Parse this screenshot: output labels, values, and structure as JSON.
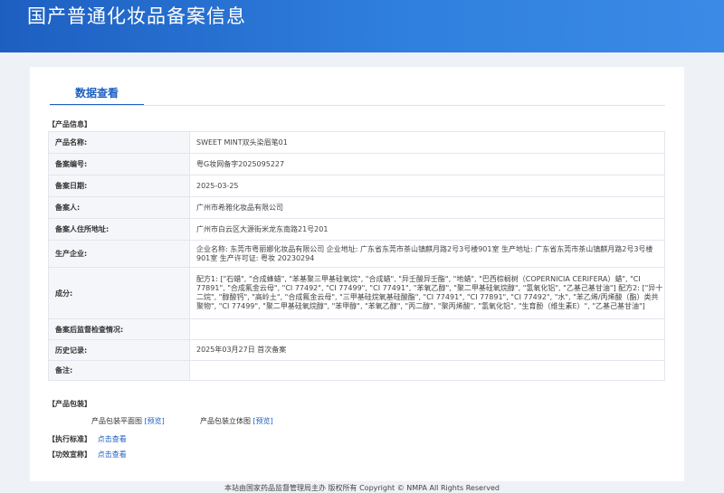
{
  "header": {
    "title": "国产普通化妆品备案信息"
  },
  "tab": {
    "label": "数据查看"
  },
  "sections": {
    "product_info": "【产品信息】",
    "packaging": "【产品包装】",
    "standard": "【执行标准】",
    "efficacy": "【功效宣称】"
  },
  "info_rows": [
    {
      "label": "产品名称:",
      "value": "SWEET MINT双头染眉笔01"
    },
    {
      "label": "备案编号:",
      "value": "粤G妆网备字2025095227"
    },
    {
      "label": "备案日期:",
      "value": "2025-03-25"
    },
    {
      "label": "备案人:",
      "value": "广州市希雅化妆品有限公司"
    },
    {
      "label": "备案人住所地址:",
      "value": "广州市白云区大源街米龙东南路21号201"
    },
    {
      "label": "生产企业:",
      "value": "企业名称: 东莞市粤丽娜化妆品有限公司 企业地址: 广东省东莞市茶山镇麒月路2号3号楼901室 生产地址: 广东省东莞市茶山镇麒月路2号3号楼901室 生产许可证: 粤妆 20230294"
    },
    {
      "label": "成分:",
      "value": "配方1: [\"石蜡\", \"合成蜂蜡\", \"苯基聚三甲基硅氧烷\", \"合成蜡\", \"异壬酸异壬酯\", \"地蜡\", \"巴西棕榈树（COPERNICIA CERIFERA）蜡\", \"CI 77891\", \"合成氟金云母\", \"CI 77492\", \"CI 77499\", \"CI 77491\", \"苯氧乙醇\", \"聚二甲基硅氧烷醇\", \"氢氧化铝\", \"乙基己基甘油\"] 配方2: [\"异十二烷\", \"醇酸钙\", \"高岭土\", \"合成氟金云母\", \"三甲基硅烷氧基硅酸酯\", \"CI 77491\", \"CI 77891\", \"CI 77492\", \"水\", \"苯乙烯/丙烯酸（酯）类共聚物\", \"CI 77499\", \"聚二甲基硅氧烷醇\", \"苯甲醇\", \"苯氧乙醇\", \"丙二醇\", \"聚丙烯酸\", \"氢氧化铝\", \"生育酚（维生素E）\", \"乙基己基甘油\"]"
    },
    {
      "label": "备案后监督检查情况:",
      "value": ""
    },
    {
      "label": "历史记录:",
      "value": "2025年03月27日 首次备案"
    },
    {
      "label": "备注:",
      "value": ""
    }
  ],
  "packaging": {
    "flat_label": "产品包装平面图",
    "solid_label": "产品包装立体图",
    "preview": "[预览]"
  },
  "links": {
    "view": "点击查看"
  },
  "footer": {
    "text": "本站由国家药品监督管理局主办 版权所有 Copyright © NMPA All Rights Reserved"
  }
}
